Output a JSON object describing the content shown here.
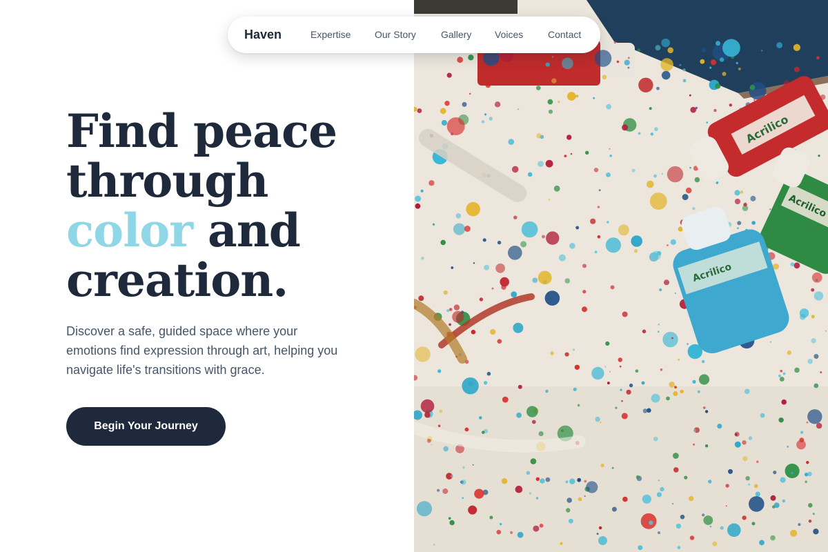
{
  "nav": {
    "brand": "Haven",
    "links": [
      "Expertise",
      "Our Story",
      "Gallery",
      "Voices",
      "Contact"
    ]
  },
  "hero": {
    "headline": {
      "line1": "Find peace",
      "line2": "through",
      "accent_word": "color",
      "line3_rest": " and",
      "line4": "creation."
    },
    "description": "Discover a safe, guided space where your emotions find expression through art, helping you navigate life's transitions with grace.",
    "cta_label": "Begin Your Journey"
  },
  "image": {
    "icon": "paint-splatter-photo",
    "bottle_labels": [
      "Acrilico",
      "Acrilico",
      "Acrilico"
    ]
  },
  "colors": {
    "primary": "#1e293b",
    "accent": "#8fd7e6",
    "muted_text": "#475569",
    "background": "#ffffff"
  }
}
